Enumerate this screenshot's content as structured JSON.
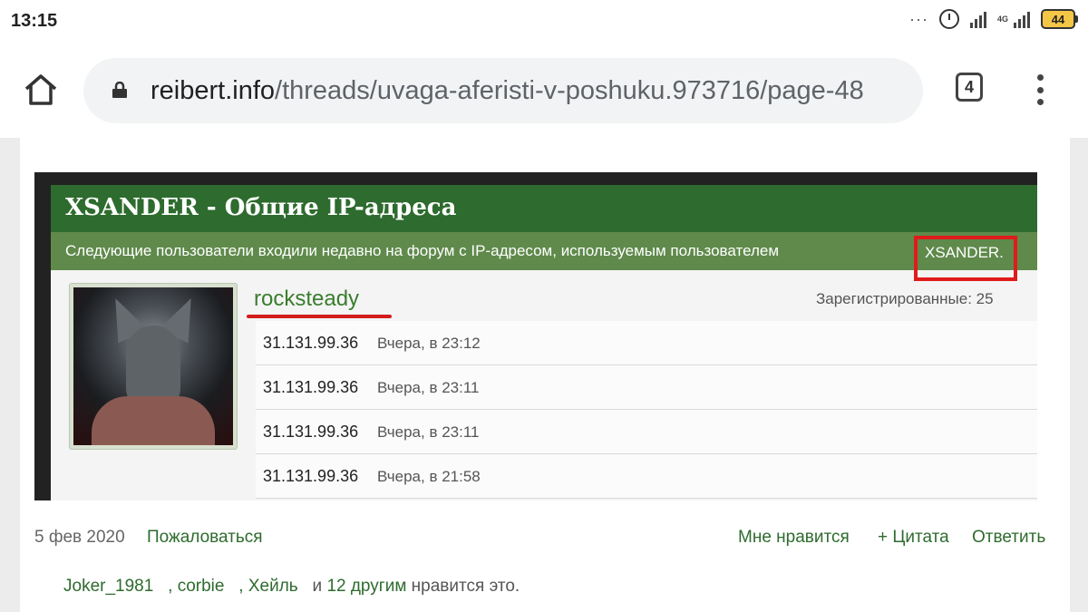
{
  "status_bar": {
    "time": "13:15",
    "network_type": "4G",
    "battery": "44"
  },
  "browser": {
    "url_host": "reibert.info",
    "url_path": "/threads/uvaga-aferisti-v-poshuku.973716/page-48",
    "tab_count": "4"
  },
  "embedded_screenshot": {
    "title": "XSANDER - Общие IP-адреса",
    "subtitle": "Следующие пользователи входили недавно на форум с IP-адресом, используемым пользователем",
    "highlighted_user": "XSANDER.",
    "username": "rocksteady",
    "registered": "Зарегистрированные: 25",
    "ip_entries": [
      {
        "ip": "31.131.99.36",
        "when": "Вчера, в 23:12"
      },
      {
        "ip": "31.131.99.36",
        "when": "Вчера, в 23:11"
      },
      {
        "ip": "31.131.99.36",
        "when": "Вчера, в 23:11"
      },
      {
        "ip": "31.131.99.36",
        "when": "Вчера, в 21:58"
      }
    ]
  },
  "post_footer": {
    "date": "5 фев 2020",
    "report": "Пожаловаться",
    "like": "Мне нравится",
    "quote": "+ Цитата",
    "reply": "Ответить"
  },
  "likes_line": {
    "user1": "Joker_1981",
    "user2": ", corbie",
    "user3": ", Хейль",
    "and": " и ",
    "others": "12 другим",
    "suffix": " нравится это."
  },
  "colors": {
    "accent_green": "#2e6b2e",
    "highlight_red": "#e01b1b"
  }
}
